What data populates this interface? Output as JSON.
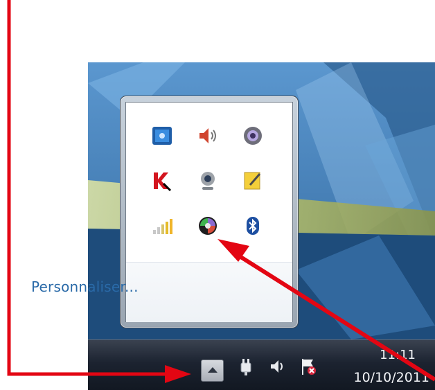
{
  "popup": {
    "customize_label": "Personnaliser...",
    "icons": [
      {
        "name": "intel-graphics-icon"
      },
      {
        "name": "volume-icon"
      },
      {
        "name": "webcam-settings-icon"
      },
      {
        "name": "kaspersky-icon"
      },
      {
        "name": "webcam-icon"
      },
      {
        "name": "notes-icon"
      },
      {
        "name": "signal-strength-icon"
      },
      {
        "name": "media-app-icon"
      },
      {
        "name": "bluetooth-icon"
      }
    ]
  },
  "taskbar": {
    "show_hidden_icons": "show-hidden-icons-button",
    "time": "11:11",
    "date": "10/10/2011"
  },
  "colors": {
    "arrow": "#e30613",
    "link": "#2a6aa8"
  }
}
